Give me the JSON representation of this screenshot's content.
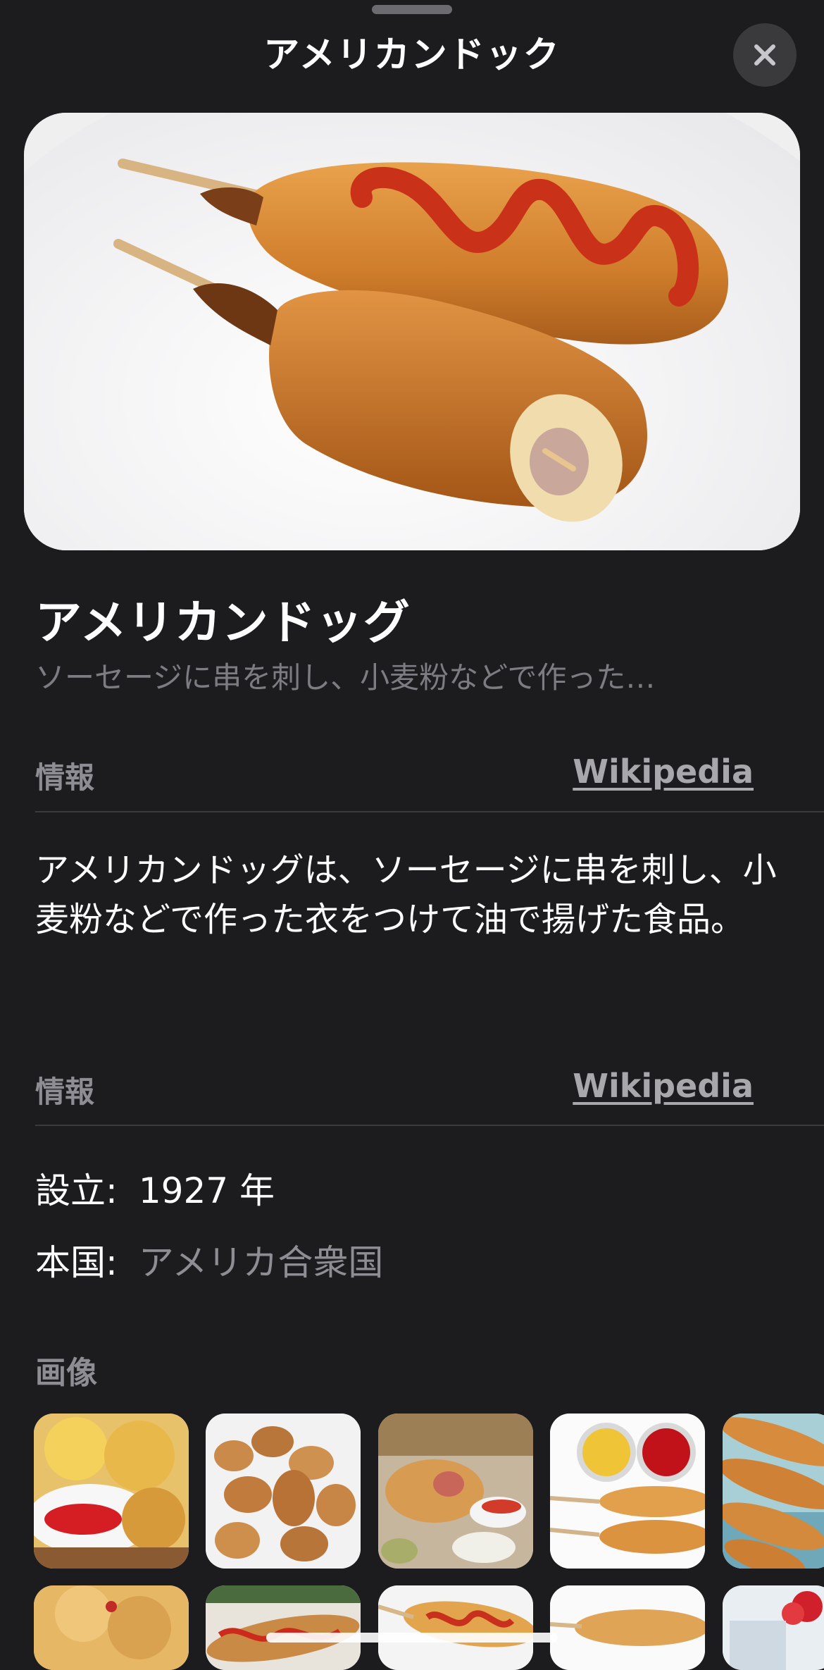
{
  "sheet": {
    "title": "アメリカンドック",
    "close_icon": "close-icon"
  },
  "hero_image": {
    "alt": "corn-dogs-photo"
  },
  "main": {
    "title": "アメリカンドッグ",
    "subtitle": "ソーセージに串を刺し、小麦粉などで作った…"
  },
  "info_sections": [
    {
      "heading": "情報",
      "source_link": "Wikipedia"
    },
    {
      "heading": "情報",
      "source_link": "Wikipedia"
    }
  ],
  "description": "アメリカンドッグは、ソーセージに串を刺し、小麦粉などで作った衣をつけて油で揚げた食品。",
  "facts": [
    {
      "label": "設立:",
      "value": "1927 年"
    },
    {
      "label": "本国:",
      "value": "アメリカ合衆国"
    }
  ],
  "images_section": {
    "heading": "画像"
  },
  "colors": {
    "background": "#1c1c1e",
    "secondary_text": "#8d8d93",
    "divider": "#3a3a3c"
  }
}
